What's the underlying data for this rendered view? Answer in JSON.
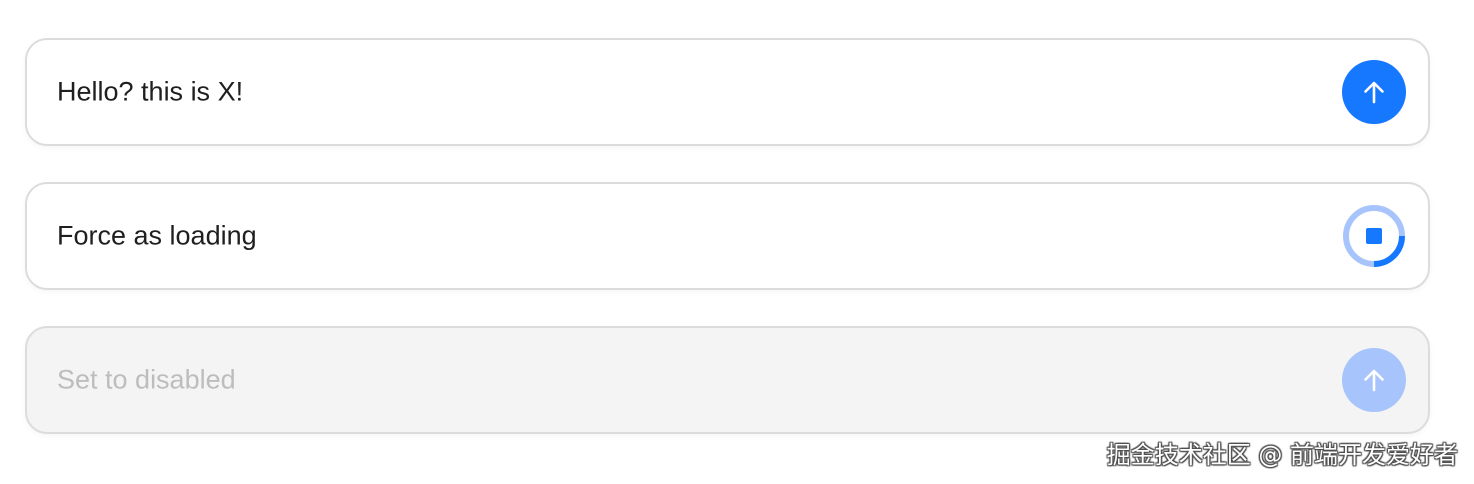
{
  "colors": {
    "primary": "#1677ff",
    "primary_disabled": "#a7c4fc",
    "loading_track": "#a7c4fc",
    "border": "#dcdcdc",
    "disabled_bg": "#f4f4f4",
    "disabled_text": "#bdbdbd"
  },
  "senders": [
    {
      "value": "Hello? this is X!",
      "state": "default",
      "button_icon": "arrow-up-icon"
    },
    {
      "value": "Force as loading",
      "state": "loading",
      "button_icon": "stop-icon"
    },
    {
      "value": "Set to disabled",
      "state": "disabled",
      "button_icon": "arrow-up-icon"
    }
  ],
  "watermark": "掘金技术社区 @ 前端开发爱好者"
}
